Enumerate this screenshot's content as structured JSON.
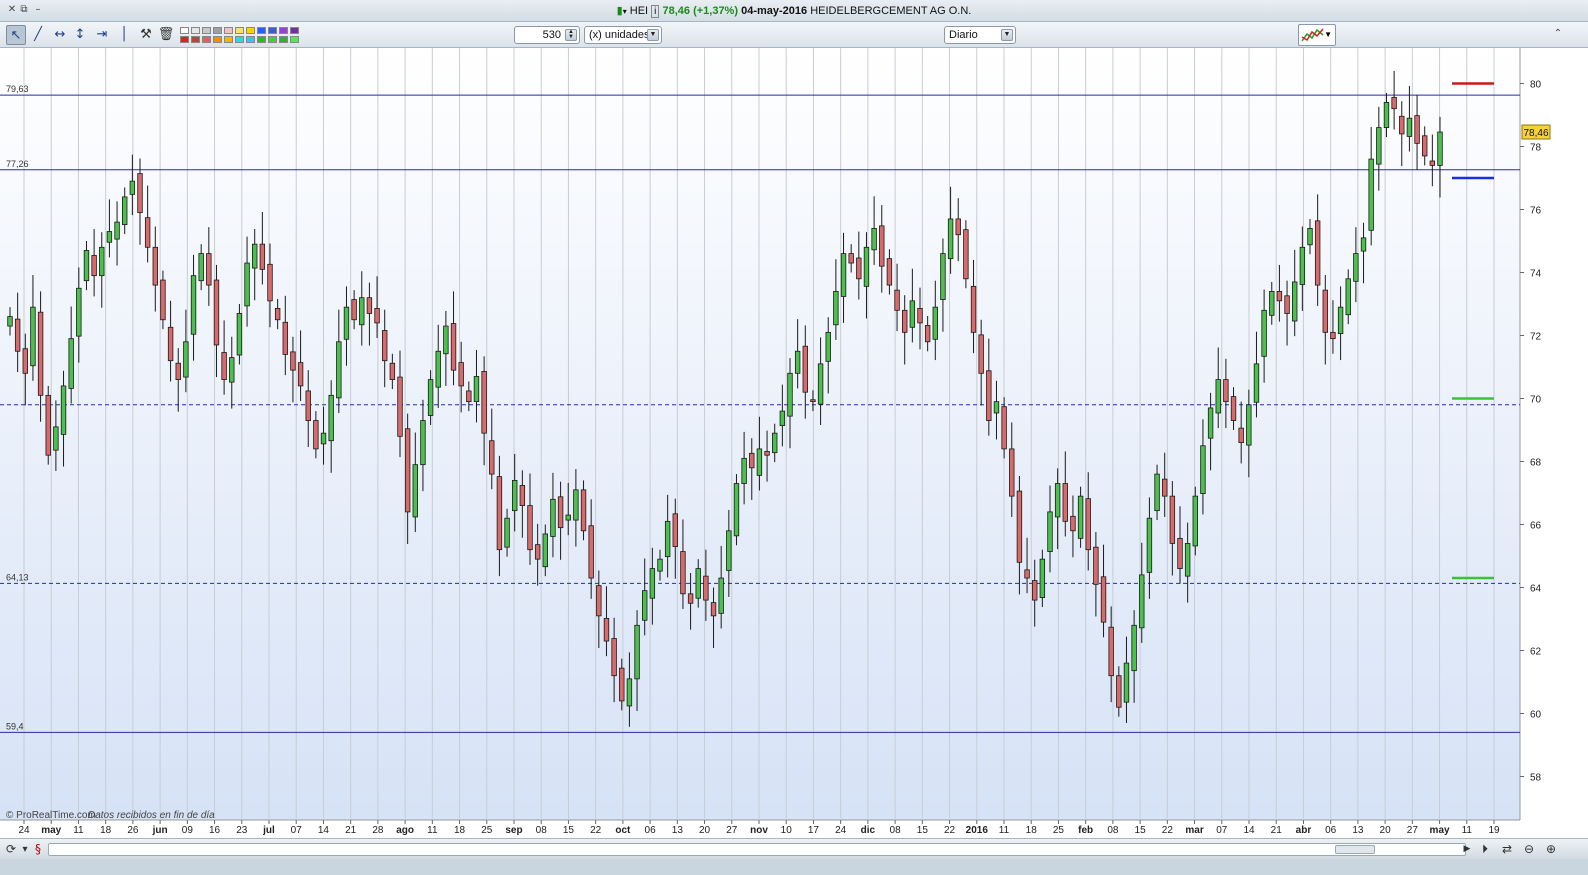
{
  "window": {
    "ticker": "HEI",
    "price": "78,46",
    "change": "(+1,37%)",
    "date": "04-may-2016",
    "company": "HEIDELBERGCEMENT AG O.N."
  },
  "toolbar": {
    "tools": [
      "pointer",
      "trendline",
      "horizontal-measure",
      "vertical-measure",
      "horizontal-line",
      "vertical-line",
      "hammer",
      "trash"
    ],
    "units_value": "530",
    "units_label": "(x) unidades",
    "period": "Diario"
  },
  "chart_data": {
    "type": "candlestick",
    "ylim": [
      57,
      81
    ],
    "yticks": [
      "58",
      "60",
      "62",
      "64",
      "66",
      "68",
      "70",
      "72",
      "74",
      "76",
      "78",
      "80"
    ],
    "last_price": "78,46",
    "hlines": [
      {
        "value": 79.63,
        "label": "79,63",
        "style": "solid"
      },
      {
        "value": 77.26,
        "label": "77,26",
        "style": "solid"
      },
      {
        "value": 69.8,
        "label": "",
        "style": "dashed"
      },
      {
        "value": 64.13,
        "label": "64,13",
        "style": "dashed"
      },
      {
        "value": 59.4,
        "label": "59,4",
        "style": "solid"
      }
    ],
    "markers": [
      {
        "value": 80.0,
        "color": "#d01818"
      },
      {
        "value": 77.0,
        "color": "#1a2ee0"
      },
      {
        "value": 70.0,
        "color": "#3ac23a"
      },
      {
        "value": 64.3,
        "color": "#3ac23a"
      }
    ],
    "xticks": [
      {
        "label": "24",
        "bold": false
      },
      {
        "label": "may",
        "bold": true
      },
      {
        "label": "11",
        "bold": false
      },
      {
        "label": "18",
        "bold": false
      },
      {
        "label": "26",
        "bold": false
      },
      {
        "label": "jun",
        "bold": true
      },
      {
        "label": "09",
        "bold": false
      },
      {
        "label": "16",
        "bold": false
      },
      {
        "label": "23",
        "bold": false
      },
      {
        "label": "jul",
        "bold": true
      },
      {
        "label": "07",
        "bold": false
      },
      {
        "label": "14",
        "bold": false
      },
      {
        "label": "21",
        "bold": false
      },
      {
        "label": "28",
        "bold": false
      },
      {
        "label": "ago",
        "bold": true
      },
      {
        "label": "11",
        "bold": false
      },
      {
        "label": "18",
        "bold": false
      },
      {
        "label": "25",
        "bold": false
      },
      {
        "label": "sep",
        "bold": true
      },
      {
        "label": "08",
        "bold": false
      },
      {
        "label": "15",
        "bold": false
      },
      {
        "label": "22",
        "bold": false
      },
      {
        "label": "oct",
        "bold": true
      },
      {
        "label": "06",
        "bold": false
      },
      {
        "label": "13",
        "bold": false
      },
      {
        "label": "20",
        "bold": false
      },
      {
        "label": "27",
        "bold": false
      },
      {
        "label": "nov",
        "bold": true
      },
      {
        "label": "10",
        "bold": false
      },
      {
        "label": "17",
        "bold": false
      },
      {
        "label": "24",
        "bold": false
      },
      {
        "label": "dic",
        "bold": true
      },
      {
        "label": "08",
        "bold": false
      },
      {
        "label": "15",
        "bold": false
      },
      {
        "label": "22",
        "bold": false
      },
      {
        "label": "2016",
        "bold": true
      },
      {
        "label": "11",
        "bold": false
      },
      {
        "label": "18",
        "bold": false
      },
      {
        "label": "25",
        "bold": false
      },
      {
        "label": "feb",
        "bold": true
      },
      {
        "label": "08",
        "bold": false
      },
      {
        "label": "15",
        "bold": false
      },
      {
        "label": "22",
        "bold": false
      },
      {
        "label": "mar",
        "bold": true
      },
      {
        "label": "07",
        "bold": false
      },
      {
        "label": "14",
        "bold": false
      },
      {
        "label": "21",
        "bold": false
      },
      {
        "label": "abr",
        "bold": true
      },
      {
        "label": "06",
        "bold": false
      },
      {
        "label": "13",
        "bold": false
      },
      {
        "label": "20",
        "bold": false
      },
      {
        "label": "27",
        "bold": false
      },
      {
        "label": "may",
        "bold": true
      },
      {
        "label": "11",
        "bold": false
      },
      {
        "label": "19",
        "bold": false
      }
    ],
    "closes": [
      72.6,
      71.5,
      70.8,
      72.9,
      70.1,
      68.2,
      69.1,
      70.4,
      71.9,
      73.5,
      74.7,
      73.9,
      74.8,
      75.3,
      75.6,
      76.4,
      76.9,
      75.9,
      74.8,
      73.6,
      72.5,
      71.2,
      70.6,
      71.8,
      73.9,
      74.6,
      73.6,
      71.7,
      70.6,
      71.3,
      72.7,
      74.3,
      74.9,
      74.1,
      73.1,
      72.5,
      71.4,
      70.9,
      70.4,
      69.3,
      68.4,
      68.9,
      70.1,
      71.8,
      72.9,
      72.5,
      73.2,
      72.7,
      72.4,
      71.2,
      70.6,
      68.8,
      66.4,
      67.9,
      69.3,
      70.6,
      71.5,
      72.3,
      70.9,
      70.4,
      69.9,
      70.7,
      68.9,
      67.6,
      65.2,
      66.2,
      67.4,
      66.6,
      65.2,
      64.9,
      65.7,
      66.8,
      65.9,
      66.3,
      67.1,
      65.8,
      64.3,
      63.1,
      62.3,
      61.2,
      60.4,
      61.1,
      62.8,
      63.9,
      64.6,
      64.9,
      66.1,
      65.3,
      63.8,
      63.5,
      64.6,
      63.6,
      63.1,
      64.3,
      65.8,
      67.3,
      68.1,
      67.8,
      68.4,
      68.2,
      68.9,
      69.6,
      70.8,
      71.5,
      70.2,
      69.9,
      71.1,
      72.1,
      73.4,
      74.6,
      74.3,
      73.8,
      74.8,
      75.4,
      74.2,
      73.6,
      72.8,
      72.1,
      73.1,
      72.4,
      71.8,
      72.9,
      74.6,
      75.7,
      75.2,
      73.8,
      72.1,
      70.8,
      69.3,
      69.9,
      68.4,
      66.9,
      64.8,
      64.3,
      63.6,
      64.9,
      66.4,
      67.3,
      66.1,
      65.8,
      66.9,
      65.2,
      64.1,
      62.9,
      61.2,
      60.2,
      61.6,
      62.8,
      64.4,
      66.2,
      67.6,
      66.9,
      65.4,
      64.6,
      65.4,
      66.9,
      68.5,
      69.7,
      70.6,
      69.9,
      69.3,
      68.6,
      69.8,
      71.1,
      72.8,
      73.4,
      73.1,
      72.7,
      73.7,
      74.8,
      75.4,
      73.6,
      72.1,
      71.9,
      72.9,
      73.8,
      74.6,
      75.1,
      77.6,
      78.6,
      79.4,
      79.2,
      78.4,
      78.9,
      78.1,
      77.7,
      77.4,
      78.46
    ]
  },
  "footer": {
    "copyright": "© ProRealTime.com",
    "status": "Datos recibidos en fin de día"
  },
  "scrollbar": {
    "icons": [
      "play-icon",
      "sync-icon",
      "zoom-out-icon",
      "zoom-in-icon"
    ]
  }
}
